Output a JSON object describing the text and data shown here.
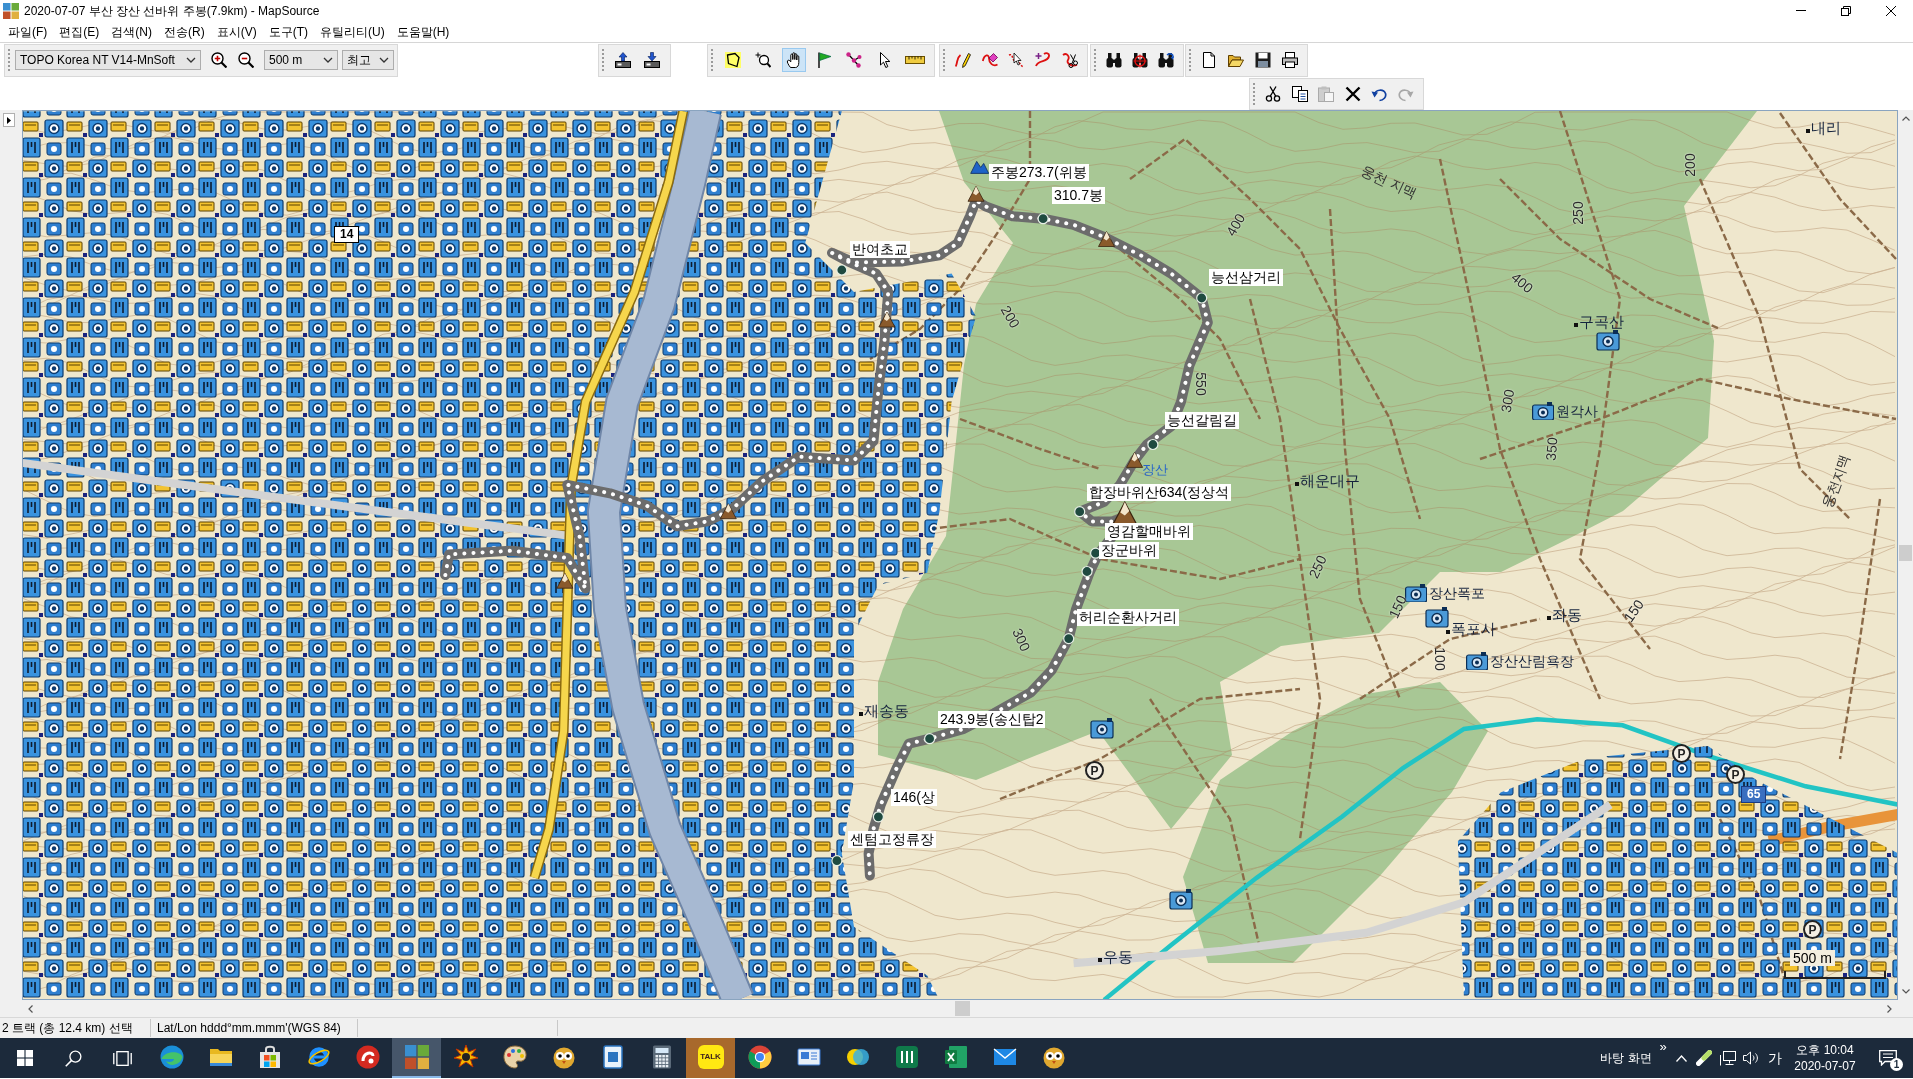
{
  "window": {
    "title": "2020-07-07 부산 장산 선바위 주봉(7.9km) - MapSource",
    "controls": [
      {
        "kind": "minimize"
      },
      {
        "kind": "restore"
      },
      {
        "kind": "close"
      }
    ]
  },
  "menu": [
    "파일(F)",
    "편집(E)",
    "검색(N)",
    "전송(R)",
    "표시(V)",
    "도구(T)",
    "유틸리티(U)",
    "도움말(H)"
  ],
  "map_toolbar": {
    "product": "TOPO Korea NT V14-MnSoft",
    "zoom": [
      {
        "kind": "zoom_in"
      },
      {
        "kind": "zoom_out"
      }
    ],
    "scale": "500 m",
    "detail": "최고"
  },
  "toolbar_groups": [
    {
      "tools": [
        {
          "kind": "send_to_device"
        },
        {
          "kind": "receive_from_device"
        }
      ]
    },
    {
      "tools": [
        {
          "kind": "map_tool",
          "selected": false
        },
        {
          "kind": "zoom_tool",
          "selected": false
        },
        {
          "kind": "hand_tool",
          "selected": true
        },
        {
          "kind": "waypoint_tool",
          "selected": false
        },
        {
          "kind": "route_tool",
          "selected": false
        },
        {
          "kind": "selection_tool",
          "selected": false
        },
        {
          "kind": "measure_tool",
          "selected": false
        }
      ]
    },
    {
      "tools": [
        {
          "kind": "track_draw"
        },
        {
          "kind": "track_erase"
        },
        {
          "kind": "track_select"
        },
        {
          "kind": "track_insert"
        },
        {
          "kind": "track_divide"
        }
      ]
    },
    {
      "tools": [
        {
          "kind": "find"
        },
        {
          "kind": "find_nearby"
        },
        {
          "kind": "find_address"
        }
      ]
    },
    {
      "tools": [
        {
          "kind": "new"
        },
        {
          "kind": "open"
        },
        {
          "kind": "save"
        },
        {
          "kind": "print"
        }
      ]
    }
  ],
  "edit_toolbar": [
    {
      "kind": "cut",
      "disabled": false
    },
    {
      "kind": "copy",
      "disabled": false
    },
    {
      "kind": "paste",
      "disabled": true
    },
    {
      "kind": "delete",
      "disabled": false
    },
    {
      "kind": "undo",
      "disabled": false
    },
    {
      "kind": "redo",
      "disabled": true
    }
  ],
  "map": {
    "waypoints": [
      {
        "label": "주봉273.7(위봉"
      },
      {
        "label": "310.7봉"
      },
      {
        "label": "반여초교"
      },
      {
        "label": "능선삼거리"
      },
      {
        "label": "능선갈림길"
      },
      {
        "label": "합장바위산634(정상석"
      },
      {
        "label": "영감할매바위"
      },
      {
        "label": "장군바위"
      },
      {
        "label": "허리순환사거리"
      },
      {
        "label": "243.9봉(송신탑2"
      },
      {
        "label": "146(상"
      },
      {
        "label": "센텀고정류장"
      }
    ],
    "places": [
      {
        "name": "내리",
        "kind": "settlement"
      },
      {
        "name": "웅천 지맥",
        "kind": "ridge"
      },
      {
        "name": "구곡산",
        "kind": "settlement"
      },
      {
        "name": "원각사",
        "kind": "attraction"
      },
      {
        "name": "해운대구",
        "kind": "settlement"
      },
      {
        "name": "장산폭포",
        "kind": "attraction"
      },
      {
        "name": "폭포사",
        "kind": "settlement"
      },
      {
        "name": "장산산림욕장",
        "kind": "attraction"
      },
      {
        "name": "좌동",
        "kind": "settlement"
      },
      {
        "name": "웅천지맥",
        "kind": "ridge"
      },
      {
        "name": "장산",
        "kind": "mountain"
      },
      {
        "name": "재송동",
        "kind": "settlement"
      },
      {
        "name": "우동",
        "kind": "settlement"
      }
    ],
    "contour_labels": [
      "400",
      "200",
      "550",
      "300",
      "200",
      "250",
      "400",
      "300",
      "350",
      "250",
      "150",
      "100",
      "150"
    ],
    "road_shields": [
      {
        "number": "14",
        "kind": "national_road"
      },
      {
        "number": "65",
        "kind": "expressway"
      }
    ],
    "parking": [
      "P",
      "P",
      "P",
      "P"
    ],
    "scale": "500 m"
  },
  "status_bar": {
    "selection": "2 트랙 (총 12.4 km) 선택",
    "position_format": "Lat/Lon hddd°mm.mmm'(WGS 84)"
  },
  "taskbar": {
    "system": [
      {
        "kind": "start"
      },
      {
        "kind": "search"
      },
      {
        "kind": "task_view"
      }
    ],
    "apps": [
      {
        "kind": "edge",
        "selected": false,
        "attention": false
      },
      {
        "kind": "file_explorer",
        "selected": false,
        "attention": false
      },
      {
        "kind": "store",
        "selected": false,
        "attention": false
      },
      {
        "kind": "internet_explorer",
        "selected": false,
        "attention": false
      },
      {
        "kind": "curl_app",
        "selected": false,
        "attention": false
      },
      {
        "kind": "mapsource",
        "selected": true,
        "attention": false
      },
      {
        "kind": "starburst_app",
        "selected": false,
        "attention": false
      },
      {
        "kind": "paint",
        "selected": false,
        "attention": false
      },
      {
        "kind": "owl_app",
        "selected": false,
        "attention": false
      },
      {
        "kind": "document_app",
        "selected": false,
        "attention": false
      },
      {
        "kind": "calculator",
        "selected": false,
        "attention": false
      },
      {
        "kind": "kakaotalk",
        "label": "TALK",
        "selected": false,
        "attention": true
      },
      {
        "kind": "chrome",
        "selected": false,
        "attention": false
      },
      {
        "kind": "photo_app",
        "selected": false,
        "attention": false
      },
      {
        "kind": "circles_app",
        "selected": false,
        "attention": false
      },
      {
        "kind": "bars_app",
        "selected": false,
        "attention": false
      },
      {
        "kind": "excel",
        "selected": false,
        "attention": false
      },
      {
        "kind": "mail",
        "selected": false,
        "attention": false
      },
      {
        "kind": "owl_app",
        "selected": false,
        "attention": false
      }
    ],
    "tray": {
      "desktop": "바탕 화면",
      "overflow": "»",
      "ime": "가",
      "time": "오후 10:04",
      "date": "2020-07-07",
      "notifications": "1"
    }
  }
}
